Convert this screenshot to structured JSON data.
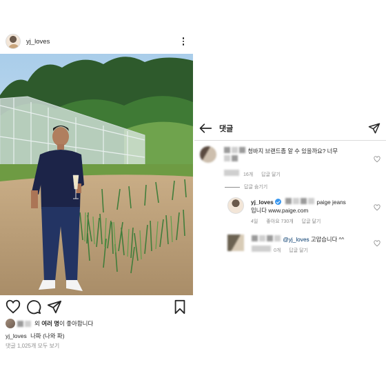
{
  "post": {
    "username": "yj_loves",
    "likes_suffix": "외",
    "likes_bold": "여러 명",
    "likes_end": "이 좋아합니다",
    "caption_user": "yj_loves",
    "caption_text": "나파 (나와 파)",
    "view_all_comments": "댓글 1,025개 모두 보기"
  },
  "icons": {
    "more": "more-options-icon",
    "like": "heart-icon",
    "comment": "comment-icon",
    "share": "share-icon",
    "save": "bookmark-icon",
    "back": "back-arrow-icon",
    "send": "direct-send-icon"
  },
  "comments": {
    "header_title": "댓글",
    "items": [
      {
        "text_visible": "청바지 브랜드좀 알 수 있을까요? 너무",
        "time": "16개",
        "reply_label": "답글 달기"
      }
    ],
    "hide_replies": "답글 숨기기",
    "reply_owner": {
      "username": "yj_loves",
      "text_brand": "paige jeans",
      "text_line2": "입니다 www.paige.com",
      "time": "4일",
      "likes": "좋아요 730개",
      "reply_label": "답글 달기"
    },
    "reply_user": {
      "mention": "@yj_loves",
      "text": "고맙습니다 ^^",
      "time": "0개",
      "reply_label": "답글 달기"
    }
  },
  "colors": {
    "text": "#262626",
    "muted": "#8e8e8e",
    "verified": "#3897f0",
    "mention": "#00376b"
  }
}
